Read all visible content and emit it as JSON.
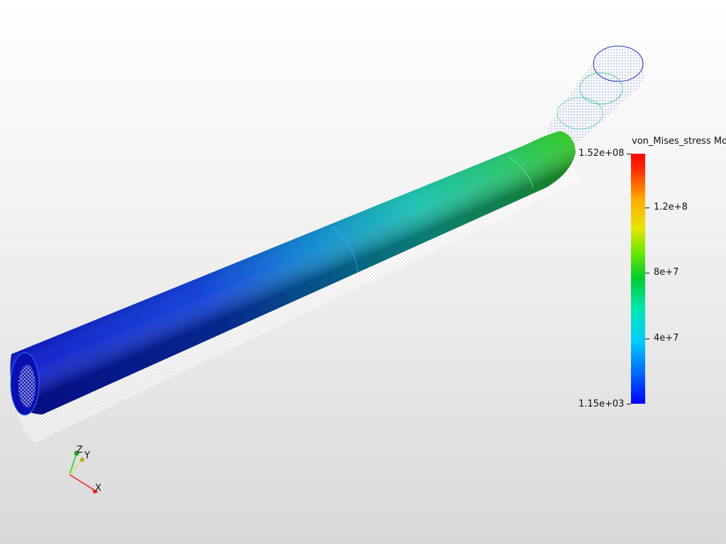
{
  "legend": {
    "title": "von_Mises_stress Mo",
    "max_label": "1.52e+08",
    "min_label": "1.15e+03",
    "ticks": [
      "1.2e+8",
      "8e+7",
      "4e+7"
    ],
    "range": [
      1150,
      152000000
    ],
    "colors": [
      "#0000ff",
      "#00ccff",
      "#00cc33",
      "#e6e600",
      "#ff0000"
    ]
  },
  "axes": {
    "x_label": "X",
    "y_label": "Y",
    "z_label": "Z"
  }
}
